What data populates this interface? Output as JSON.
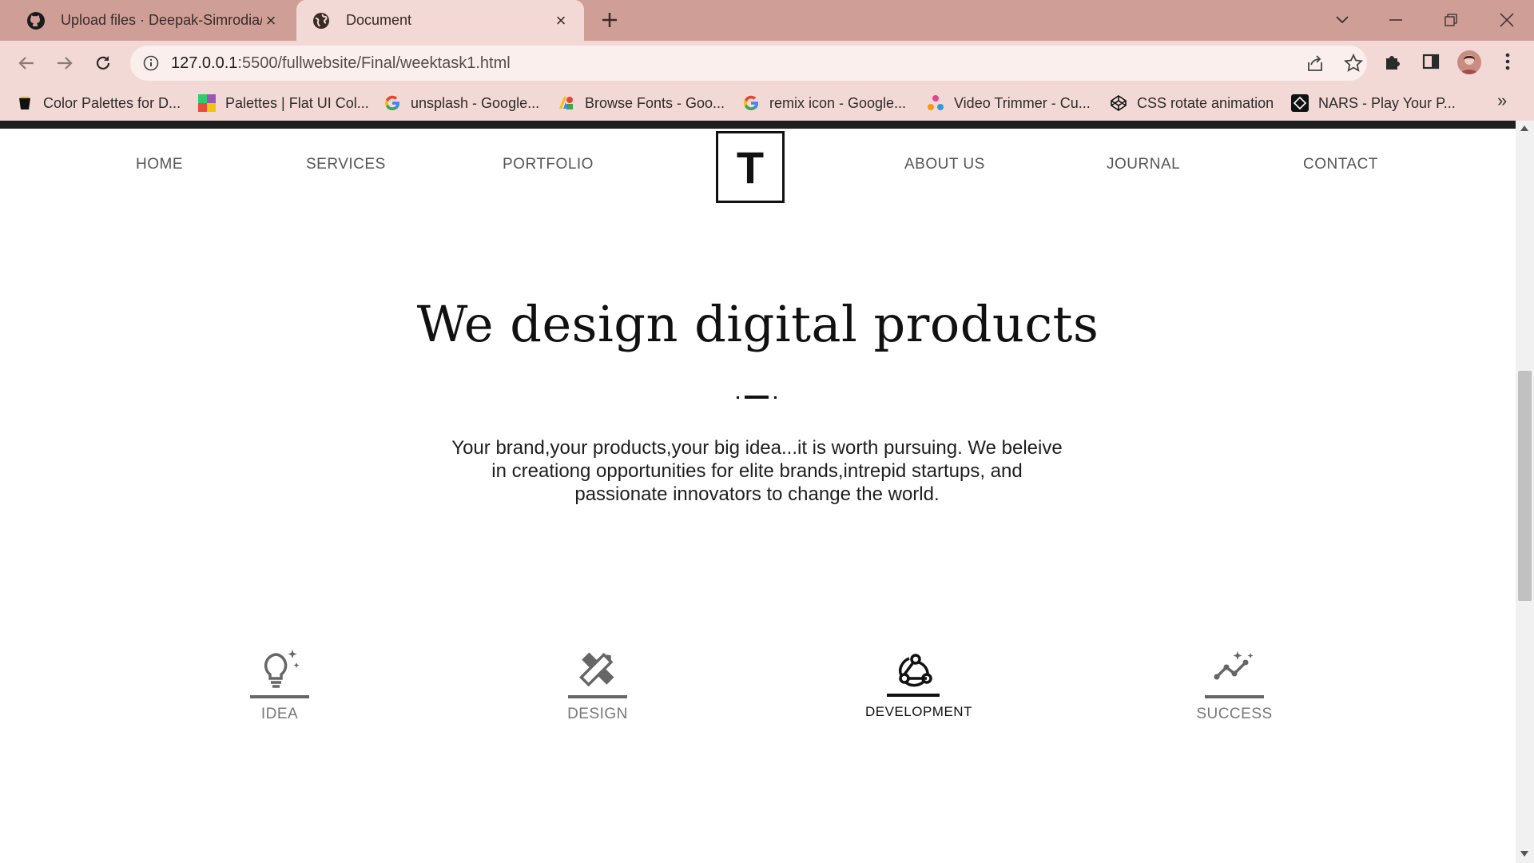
{
  "browser": {
    "tabs": [
      {
        "title": "Upload files · Deepak-Simrodia/w",
        "icon": "github-icon"
      },
      {
        "title": "Document",
        "icon": "globe-icon"
      }
    ],
    "url_host": "127.0.0.1",
    "url_path": ":5500/fullwebsite/Final/weektask1.html",
    "bookmarks": [
      {
        "label": "Color Palettes for D...",
        "icon": "palette-bookmark-icon"
      },
      {
        "label": "Palettes | Flat UI Col...",
        "icon": "flatui-bookmark-icon"
      },
      {
        "label": "unsplash - Google...",
        "icon": "google-icon"
      },
      {
        "label": "Browse Fonts - Goo...",
        "icon": "google-fonts-icon"
      },
      {
        "label": "remix icon - Google...",
        "icon": "google-icon"
      },
      {
        "label": "Video Trimmer - Cu...",
        "icon": "video-trimmer-icon"
      },
      {
        "label": "CSS rotate animation",
        "icon": "codepen-icon"
      },
      {
        "label": "NARS - Play Your P...",
        "icon": "nars-icon"
      }
    ],
    "colors": {
      "frame": "#cf9f97",
      "toolbar": "#f2d9d5"
    }
  },
  "site": {
    "nav_left": [
      "HOME",
      "SERVICES",
      "PORTFOLIO"
    ],
    "logo": "T",
    "nav_right": [
      "ABOUT US",
      "JOURNAL",
      "CONTACT"
    ],
    "headline": "We design digital products",
    "paragraph": "Your brand,your products,your big idea...it is worth pursuing. We beleive in creationg opportunities for elite brands,intrepid startups, and passionate innovators to change the world.",
    "features": [
      {
        "label": "IDEA",
        "icon": "lightbulb-icon",
        "active": false
      },
      {
        "label": "DESIGN",
        "icon": "pencil-ruler-icon",
        "active": false
      },
      {
        "label": "DEVELOPMENT",
        "icon": "webhook-icon",
        "active": true
      },
      {
        "label": "SUCCESS",
        "icon": "sparkle-chart-icon",
        "active": false
      }
    ]
  }
}
